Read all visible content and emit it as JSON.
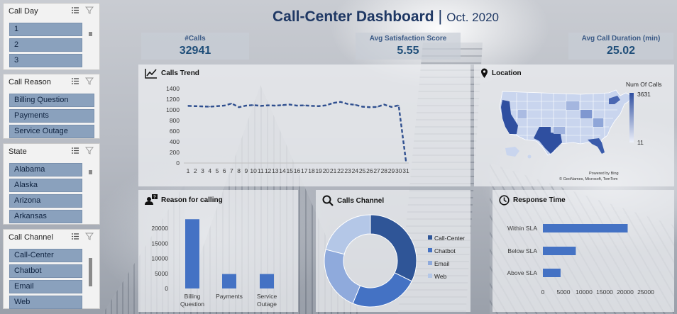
{
  "title": {
    "main": "Call-Center Dashboard",
    "separator": "|",
    "sub": "Oct. 2020"
  },
  "slicers": [
    {
      "label": "Call Day",
      "items": [
        "1",
        "2",
        "3"
      ]
    },
    {
      "label": "Call Reason",
      "items": [
        "Billing Question",
        "Payments",
        "Service Outage"
      ]
    },
    {
      "label": "State",
      "items": [
        "Alabama",
        "Alaska",
        "Arizona",
        "Arkansas"
      ]
    },
    {
      "label": "Call Channel",
      "items": [
        "Call-Center",
        "Chatbot",
        "Email",
        "Web"
      ]
    }
  ],
  "kpis": {
    "calls": {
      "label": "#Calls",
      "value": "32941"
    },
    "satisfaction": {
      "label": "Avg Satisfaction Score",
      "value": "5.55"
    },
    "duration": {
      "label": "Avg Call Duration (min)",
      "value": "25.02"
    }
  },
  "panels": {
    "trend": "Calls Trend",
    "location": "Location",
    "reason": "Reason for calling",
    "channel": "Calls Channel",
    "response": "Response Time"
  },
  "map": {
    "legend_title": "Num Of Calls",
    "legend_max": "3631",
    "legend_min": "11",
    "credit_1": "Powered by Bing",
    "credit_2": "© GeoNames, Microsoft, TomTom",
    "colors": {
      "low": "#dde4f3",
      "high": "#2f4fa0"
    }
  },
  "colors": {
    "accent": "#1f3864",
    "bar": "#4472c4",
    "trend_line": "#2f4f8f"
  },
  "chart_data": [
    {
      "type": "line",
      "title": "Calls Trend",
      "x": [
        1,
        2,
        3,
        4,
        5,
        6,
        7,
        8,
        9,
        10,
        11,
        12,
        13,
        14,
        15,
        16,
        17,
        18,
        19,
        20,
        21,
        22,
        23,
        24,
        25,
        26,
        27,
        28,
        29,
        30,
        31
      ],
      "series": [
        {
          "values": [
            1075,
            1070,
            1065,
            1060,
            1070,
            1080,
            1120,
            1050,
            1080,
            1090,
            1075,
            1085,
            1080,
            1090,
            1100,
            1080,
            1085,
            1075,
            1070,
            1085,
            1130,
            1150,
            1110,
            1095,
            1060,
            1050,
            1055,
            1100,
            1055,
            1085,
            40
          ]
        }
      ],
      "ylim": [
        0,
        1400
      ],
      "yticks": [
        0,
        200,
        400,
        600,
        800,
        1000,
        1200,
        1400
      ]
    },
    {
      "type": "bar",
      "title": "Reason for calling",
      "categories": [
        "Billing Question",
        "Payments",
        "Service Outage"
      ],
      "values": [
        23000,
        4800,
        4800
      ],
      "ylim": [
        0,
        20000
      ],
      "yticks": [
        0,
        5000,
        10000,
        15000,
        20000
      ]
    },
    {
      "type": "pie",
      "title": "Calls Channel",
      "categories": [
        "Call-Center",
        "Chatbot",
        "Email",
        "Web"
      ],
      "values": [
        10639,
        7890,
        7487,
        6925
      ],
      "colors": [
        "#2f5597",
        "#4472c4",
        "#8faadc",
        "#b4c7e7"
      ]
    },
    {
      "type": "bar",
      "title": "Response Time",
      "categories": [
        "Within SLA",
        "Below SLA",
        "Above SLA"
      ],
      "values": [
        20600,
        8000,
        4300
      ],
      "xlim": [
        0,
        25000
      ],
      "xticks": [
        0,
        5000,
        10000,
        15000,
        20000,
        25000
      ]
    }
  ]
}
